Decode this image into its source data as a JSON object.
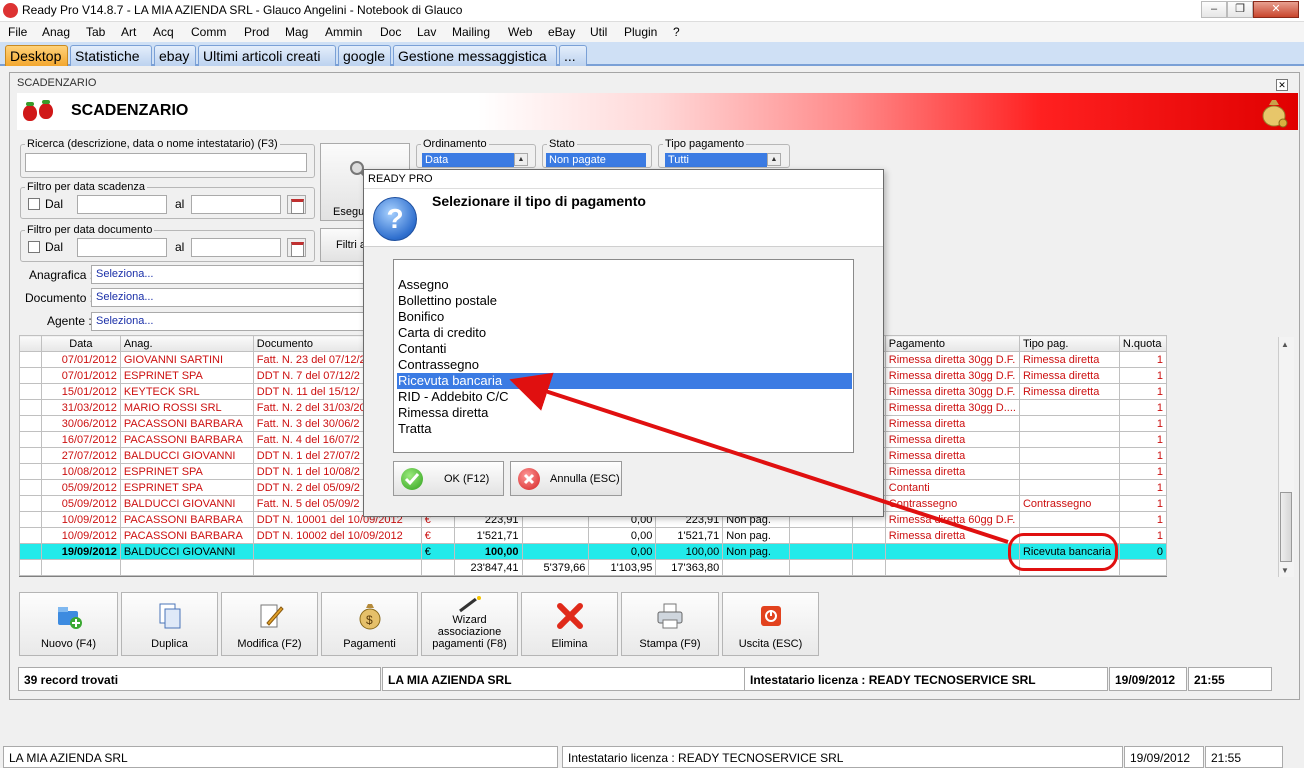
{
  "window": {
    "title": "Ready Pro V14.8.7 - LA MIA AZIENDA SRL - Glauco Angelini - Notebook di Glauco"
  },
  "menu": [
    "File",
    "Anag",
    "Tab",
    "Art",
    "Acq",
    "Comm",
    "Prod",
    "Mag",
    "Ammin",
    "Doc",
    "Lav",
    "Mailing",
    "Web",
    "eBay",
    "Util",
    "Plugin",
    "?"
  ],
  "tabs": [
    "Desktop",
    "Statistiche",
    "ebay",
    "Ultimi articoli creati",
    "google",
    "Gestione messaggistica",
    "..."
  ],
  "module": {
    "label": "SCADENZARIO",
    "title": "SCADENZARIO"
  },
  "filters": {
    "search_legend": "Ricerca (descrizione, data o nome intestatario) (F3)",
    "scad_legend": "Filtro per data scadenza",
    "doc_legend": "Filtro per data documento",
    "dal": "Dal",
    "al": "al",
    "esegui_btn": "Esegui",
    "filtri_btn": "Filtri a",
    "anagrafica_label": "Anagrafica :",
    "documento_label": "Documento :",
    "agente_label": "Agente :",
    "seleziona": "Seleziona...",
    "ordinamento_legend": "Ordinamento",
    "ordinamento_value": "Data",
    "stato_legend": "Stato",
    "stato_value": "Non pagate",
    "tipo_legend": "Tipo pagamento",
    "tipo_value": "Tutti"
  },
  "grid": {
    "headers": {
      "data": "Data",
      "anag": "Anag.",
      "documento": "Documento",
      "pagamento": "Pagamento",
      "tipo_pag": "Tipo pag.",
      "nquota": "N.quota"
    },
    "rows": [
      {
        "data": "07/01/2012",
        "anag": "GIOVANNI SARTINI",
        "doc": "Fatt. N. 23 del 07/12/2",
        "pag": "Rimessa diretta 30gg D.F.",
        "tipo": "Rimessa diretta",
        "nq": "1"
      },
      {
        "data": "07/01/2012",
        "anag": "ESPRINET SPA",
        "doc": "DDT N. 7 del 07/12/2",
        "pag": "Rimessa diretta 30gg D.F.",
        "tipo": "Rimessa diretta",
        "nq": "1"
      },
      {
        "data": "15/01/2012",
        "anag": "KEYTECK SRL",
        "doc": "DDT N. 11 del 15/12/",
        "pag": "Rimessa diretta 30gg D.F.",
        "tipo": "Rimessa diretta",
        "nq": "1"
      },
      {
        "data": "31/03/2012",
        "anag": "MARIO ROSSI SRL",
        "doc": "Fatt. N. 2 del 31/03/20",
        "pag": "Rimessa diretta 30gg D....",
        "tipo": "",
        "nq": "1"
      },
      {
        "data": "30/06/2012",
        "anag": "PACASSONI BARBARA",
        "doc": "Fatt. N. 3 del 30/06/2",
        "pag": "Rimessa diretta",
        "tipo": "",
        "nq": "1"
      },
      {
        "data": "16/07/2012",
        "anag": "PACASSONI BARBARA",
        "doc": "Fatt. N. 4 del 16/07/2",
        "pag": "Rimessa diretta",
        "tipo": "",
        "nq": "1"
      },
      {
        "data": "27/07/2012",
        "anag": "BALDUCCI GIOVANNI",
        "doc": "DDT N. 1 del 27/07/2",
        "pag": "Rimessa diretta",
        "tipo": "",
        "nq": "1"
      },
      {
        "data": "10/08/2012",
        "anag": "ESPRINET SPA",
        "doc": "DDT N. 1 del 10/08/2",
        "pag": "Rimessa diretta",
        "tipo": "",
        "nq": "1"
      },
      {
        "data": "05/09/2012",
        "anag": "ESPRINET SPA",
        "doc": "DDT N. 2 del 05/09/2",
        "pag": "Contanti",
        "tipo": "",
        "nq": "1"
      },
      {
        "data": "05/09/2012",
        "anag": "BALDUCCI GIOVANNI",
        "doc": "Fatt. N. 5 del 05/09/2",
        "pag": "Contrassegno",
        "tipo": "Contrassegno",
        "nq": "1"
      },
      {
        "data": "10/09/2012",
        "anag": "PACASSONI BARBARA",
        "doc": "DDT N. 10001 del 10/09/2012",
        "cur": "€",
        "imp": "223,91",
        "c1": "",
        "c2": "0,00",
        "c3": "223,91",
        "st": "Non pag.",
        "pag": "Rimessa diretta 60gg D.F.",
        "tipo": "",
        "nq": "1"
      },
      {
        "data": "10/09/2012",
        "anag": "PACASSONI BARBARA",
        "doc": "DDT N. 10002 del 10/09/2012",
        "cur": "€",
        "imp": "1'521,71",
        "c1": "",
        "c2": "0,00",
        "c3": "1'521,71",
        "st": "Non pag.",
        "pag": "Rimessa diretta",
        "tipo": "",
        "nq": "1"
      }
    ],
    "selected": {
      "data": "19/09/2012",
      "anag": "BALDUCCI GIOVANNI",
      "doc": "",
      "cur": "€",
      "imp": "100,00",
      "c1": "",
      "c2": "0,00",
      "c3": "100,00",
      "st": "Non pag.",
      "pag": "",
      "tipo": "Ricevuta bancaria",
      "nq": "0"
    },
    "totals": {
      "imp": "23'847,41",
      "c1": "5'379,66",
      "c2": "1'103,95",
      "c3": "17'363,80"
    }
  },
  "toolbar": {
    "nuovo": "Nuovo (F4)",
    "duplica": "Duplica",
    "modifica": "Modifica (F2)",
    "pagamenti": "Pagamenti",
    "wizard1": "Wizard",
    "wizard2": "associazione",
    "wizard3": "pagamenti (F8)",
    "elimina": "Elimina",
    "stampa": "Stampa (F9)",
    "uscita": "Uscita (ESC)"
  },
  "status": {
    "records": "39 record trovati",
    "company": "LA MIA AZIENDA SRL",
    "license": "Intestatario licenza : READY TECNOSERVICE SRL",
    "date": "19/09/2012",
    "time": "21:55"
  },
  "dialog": {
    "title": "READY PRO",
    "message": "Selezionare il tipo di pagamento",
    "options": [
      "Assegno",
      "Bollettino postale",
      "Bonifico",
      "Carta di credito",
      "Contanti",
      "Contrassegno",
      "Ricevuta bancaria",
      "RID - Addebito C/C",
      "Rimessa diretta",
      "Tratta"
    ],
    "selected_index": 6,
    "ok": "OK (F12)",
    "cancel": "Annulla (ESC)"
  },
  "colors": {
    "accent": "#3b7be3",
    "selection_row": "#22eaea",
    "red_text": "#cc1010",
    "callout": "#e01010"
  }
}
